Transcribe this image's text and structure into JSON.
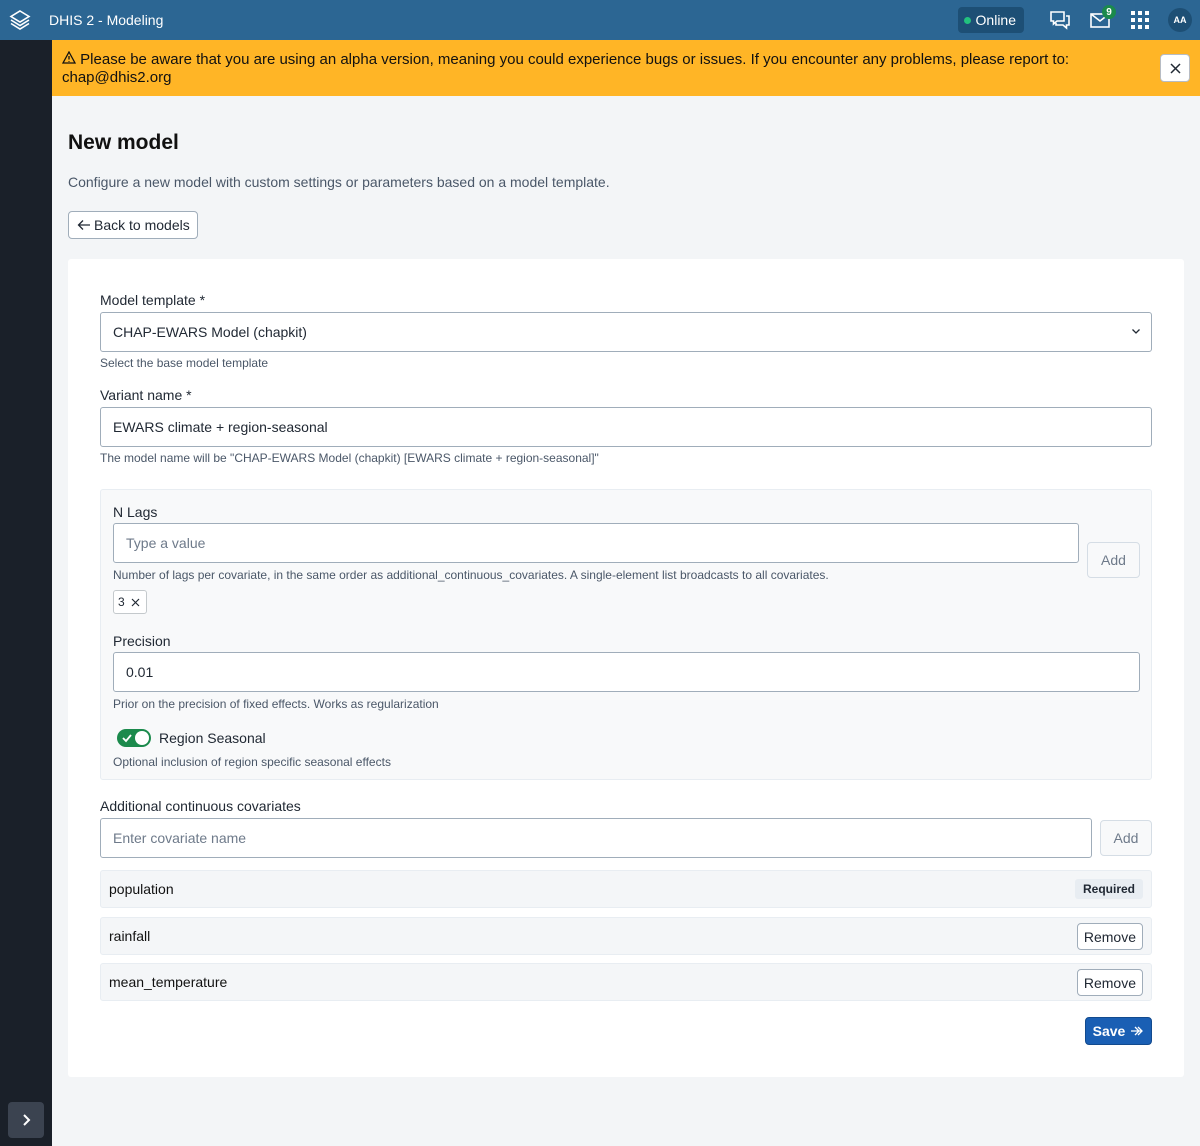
{
  "header": {
    "app_title": "DHIS 2 - Modeling",
    "status": "Online",
    "mail_count": "9",
    "avatar_initials": "AA"
  },
  "alert": {
    "icon": "warning-icon",
    "message": "Please be aware that you are using an alpha version, meaning you could experience bugs or issues. If you encounter any problems, please report to: chap@dhis2.org"
  },
  "page": {
    "title": "New model",
    "description": "Configure a new model with custom settings or parameters based on a model template.",
    "back_label": "Back to models"
  },
  "form": {
    "model_template": {
      "label": "Model template *",
      "value": "CHAP-EWARS Model (chapkit)",
      "help": "Select the base model template"
    },
    "variant_name": {
      "label": "Variant name *",
      "value": "EWARS climate + region-seasonal",
      "help": "The model name will be \"CHAP-EWARS Model (chapkit) [EWARS climate + region-seasonal]\""
    },
    "n_lags": {
      "label": "N Lags",
      "placeholder": "Type a value",
      "add_label": "Add",
      "help": "Number of lags per covariate, in the same order as additional_continuous_covariates. A single-element list broadcasts to all covariates.",
      "chips": [
        "3"
      ]
    },
    "precision": {
      "label": "Precision",
      "value": "0.01",
      "help": "Prior on the precision of fixed effects. Works as regularization"
    },
    "region_seasonal": {
      "label": "Region Seasonal",
      "checked": true,
      "help": "Optional inclusion of region specific seasonal effects"
    },
    "covariates": {
      "label": "Additional continuous covariates",
      "placeholder": "Enter covariate name",
      "add_label": "Add",
      "required_label": "Required",
      "remove_label": "Remove",
      "items": [
        "population",
        "rainfall",
        "mean_temperature"
      ]
    },
    "save_label": "Save"
  },
  "colors": {
    "header": "#2c6693",
    "alert": "#ffb526",
    "toggle_on": "#1b8a4c",
    "primary": "#1a5fb4"
  }
}
